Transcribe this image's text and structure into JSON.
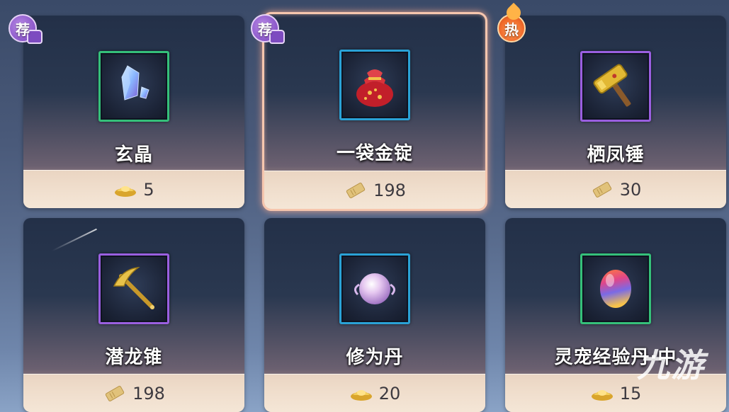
{
  "items": [
    {
      "name": "玄晶",
      "price": "5",
      "currency": "gold-ingot-icon",
      "frame": "green",
      "badge": "荐",
      "badge_type": "rec",
      "item_icon": "crystal-icon",
      "selected": false
    },
    {
      "name": "一袋金锭",
      "price": "198",
      "currency": "ticket-icon",
      "frame": "blue",
      "badge": "荐",
      "badge_type": "rec",
      "item_icon": "money-bag-icon",
      "selected": true
    },
    {
      "name": "栖凤锤",
      "price": "30",
      "currency": "ticket-icon",
      "frame": "purple",
      "badge": "热",
      "badge_type": "hot",
      "item_icon": "hammer-icon",
      "selected": false
    },
    {
      "name": "潜龙锥",
      "price": "198",
      "currency": "ticket-icon",
      "frame": "purple",
      "badge": "",
      "badge_type": "",
      "item_icon": "pickaxe-icon",
      "selected": false
    },
    {
      "name": "修为丹",
      "price": "20",
      "currency": "gold-ingot-icon",
      "frame": "blue",
      "badge": "",
      "badge_type": "",
      "item_icon": "pearl-orb-icon",
      "selected": false
    },
    {
      "name": "灵宠经验丹·中",
      "price": "15",
      "currency": "gold-ingot-icon",
      "frame": "green",
      "badge": "",
      "badge_type": "",
      "item_icon": "rainbow-egg-icon",
      "selected": false
    }
  ],
  "watermark": "九游",
  "colors": {
    "frame_green": "#35c07a",
    "frame_blue": "#2aa2d6",
    "frame_purple": "#9a5fe0",
    "selected_glow": "#f6c6ae",
    "price_bar": "#f1e0cf"
  }
}
